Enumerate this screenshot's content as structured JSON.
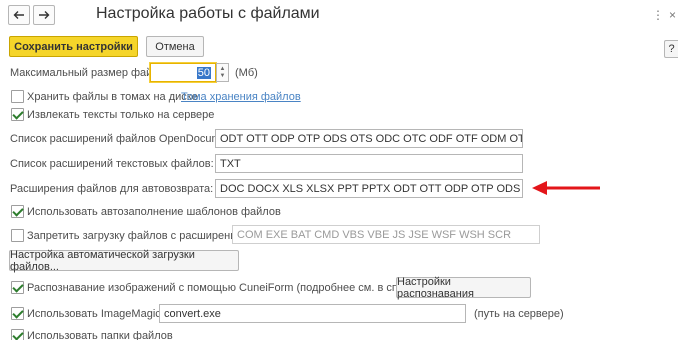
{
  "window": {
    "title": "Настройка работы с файлами",
    "back_icon": "arrow-left-icon",
    "forward_icon": "arrow-right-icon",
    "more_glyph": "⋮",
    "close_glyph": "×"
  },
  "toolbar": {
    "save_label": "Сохранить настройки",
    "cancel_label": "Отмена",
    "help_label": "?"
  },
  "max_size": {
    "label": "Максимальный размер файла:",
    "value": "50",
    "unit": "(Мб)"
  },
  "store_in_volumes": {
    "label": "Хранить файлы в томах на диске",
    "checked": false,
    "link": "Тома хранения файлов"
  },
  "extract_text": {
    "label": "Извлекать тексты только на сервере",
    "checked": true
  },
  "opendocument_ext": {
    "label": "Список расширений файлов OpenDocument:",
    "value": "ODT OTT ODP OTP ODS OTS ODC OTC ODF OTF ODM OTH SDW"
  },
  "text_ext": {
    "label": "Список расширений текстовых файлов:",
    "value": "TXT"
  },
  "autoreturn_ext": {
    "label": "Расширения файлов для автовозврата:",
    "value": "DOC DOCX XLS XLSX PPT PPTX ODT OTT ODP OTP ODS OTS ODC"
  },
  "template_autofill": {
    "label": "Использовать автозаполнение шаблонов файлов",
    "checked": true
  },
  "forbid_upload": {
    "label": "Запретить загрузку файлов с расширением:",
    "checked": false,
    "value": "COM EXE BAT CMD VBS VBE JS JSE WSF WSH SCR"
  },
  "auto_upload_button": "Настройка автоматической загрузки файлов...",
  "cuneiform": {
    "label": "Распознавание изображений с помощью CuneiForm (подробнее см. в справке)",
    "checked": true,
    "button": "Настройки распознавания"
  },
  "imagemagick": {
    "label": "Использовать ImageMagick",
    "checked": true,
    "value": "convert.exe",
    "note": "(путь на сервере)"
  },
  "file_folders": {
    "label": "Использовать папки файлов",
    "checked": true
  },
  "annotation": {
    "arrow_color": "#e3151a"
  }
}
